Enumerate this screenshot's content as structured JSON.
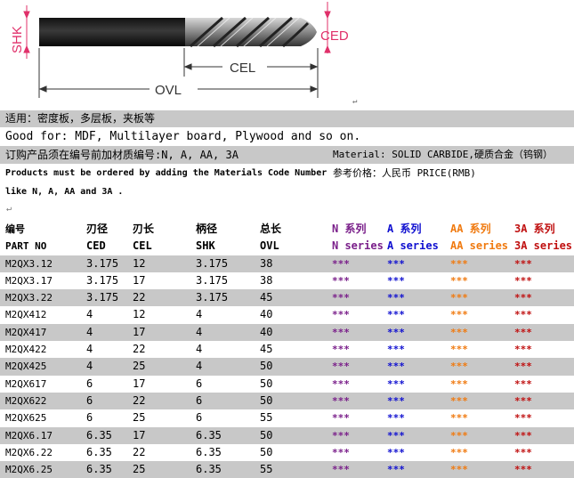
{
  "drawing": {
    "dim_labels": {
      "shk": "SHK",
      "ced": "CED",
      "cel": "CEL",
      "ovl": "OVL"
    }
  },
  "notes": {
    "usage_cn": "适用：密度板，多层板，夹板等",
    "usage_en": "Good for: MDF, Multilayer board, Plywood and so on.",
    "order_cn": "订购产品须在编号前加材质编号:N, A, AA, 3A",
    "material": "Material:  SOLID CARBIDE,硬质合金（钨钢）",
    "order_en_1": "Products must be ordered by adding the Materials Code Number",
    "price": "参考价格：人民币  PRICE(RMB)",
    "order_en_2": "like N, A, AA and 3A ."
  },
  "table": {
    "header_cn": [
      "编号",
      "刃径",
      "刃长",
      "柄径",
      "总长",
      "N 系列",
      "A 系列",
      "AA 系列",
      "3A 系列"
    ],
    "header_en": [
      "PART NO",
      "CED",
      "CEL",
      "SHK",
      "OVL",
      "N series",
      "A series",
      "AA series",
      "3A series"
    ],
    "stars": "***",
    "rows": [
      [
        "M2QX3.12",
        "3.175",
        "12",
        "3.175",
        "38"
      ],
      [
        "M2QX3.17",
        "3.175",
        "17",
        "3.175",
        "38"
      ],
      [
        "M2QX3.22",
        "3.175",
        "22",
        "3.175",
        "45"
      ],
      [
        "M2QX412",
        "4",
        "12",
        "4",
        "40"
      ],
      [
        "M2QX417",
        "4",
        "17",
        "4",
        "40"
      ],
      [
        "M2QX422",
        "4",
        "22",
        "4",
        "45"
      ],
      [
        "M2QX425",
        "4",
        "25",
        "4",
        "50"
      ],
      [
        "M2QX617",
        "6",
        "17",
        "6",
        "50"
      ],
      [
        "M2QX622",
        "6",
        "22",
        "6",
        "50"
      ],
      [
        "M2QX625",
        "6",
        "25",
        "6",
        "55"
      ],
      [
        "M2QX6.17",
        "6.35",
        "17",
        "6.35",
        "50"
      ],
      [
        "M2QX6.22",
        "6.35",
        "22",
        "6.35",
        "50"
      ],
      [
        "M2QX6.25",
        "6.35",
        "25",
        "6.35",
        "55"
      ]
    ]
  },
  "colors": {
    "n_series": "#7a1f8a",
    "a_series": "#1010d0",
    "aa_series": "#f07a10",
    "a3_series": "#c01010",
    "band_gray": "#c8c8c8"
  }
}
